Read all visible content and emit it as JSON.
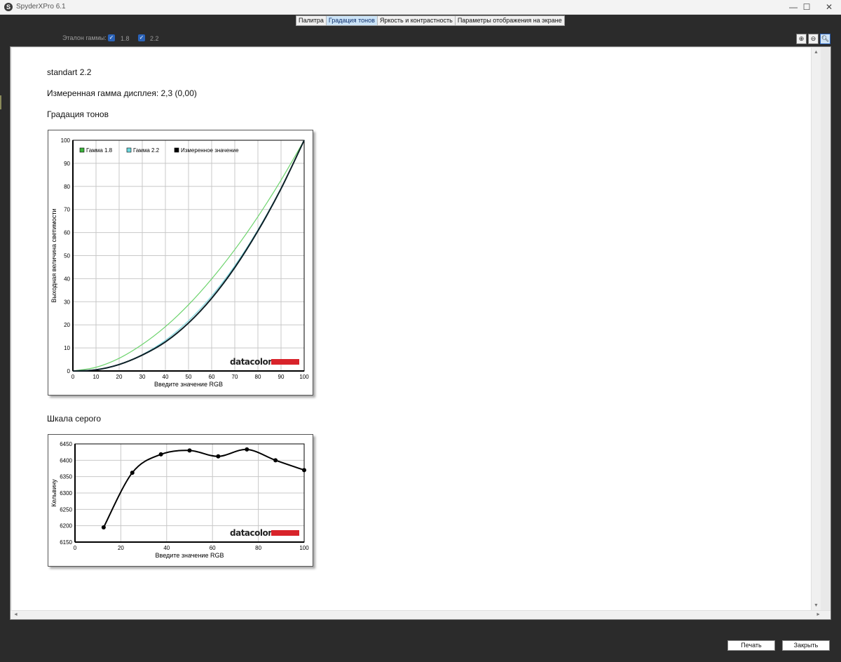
{
  "window": {
    "title": "SpyderXPro 6.1",
    "icon_text": "S",
    "controls": {
      "minimize": "—",
      "maximize": "☐",
      "close": "✕"
    }
  },
  "tabs": [
    {
      "label": "Палитра",
      "active": false
    },
    {
      "label": "Градация тонов",
      "active": true
    },
    {
      "label": "Яркость и контрастность",
      "active": false
    },
    {
      "label": "Параметры отображения на экране",
      "active": false
    }
  ],
  "gamma_reference": {
    "label": "Эталон гаммы:",
    "options": [
      {
        "label": "1.8",
        "checked": true
      },
      {
        "label": "2.2",
        "checked": true
      }
    ],
    "check_glyph": "✓"
  },
  "zoom_buttons": [
    {
      "icon": "zoom-in-icon",
      "glyph": "⊕"
    },
    {
      "icon": "zoom-out-icon",
      "glyph": "⊖"
    },
    {
      "icon": "zoom-fit-icon",
      "glyph": "🔍︎"
    }
  ],
  "report": {
    "profile_name": "standart 2.2",
    "measured_gamma": "Измеренная гамма дисплея: 2,3 (0,00)",
    "tone_section_title": "Градация тонов",
    "gray_section_title": "Шкала серого"
  },
  "chart_data": [
    {
      "type": "line",
      "title": "",
      "xlabel": "Введите значение RGB",
      "ylabel": "Выходная величина светимости",
      "xlim": [
        0,
        100
      ],
      "ylim": [
        0,
        100
      ],
      "x_ticks": [
        0,
        10,
        20,
        30,
        40,
        50,
        60,
        70,
        80,
        90,
        100
      ],
      "y_ticks": [
        0,
        10,
        20,
        30,
        40,
        50,
        60,
        70,
        80,
        90,
        100
      ],
      "grid": true,
      "legend_position": "top-left",
      "watermark": "datacolor",
      "series": [
        {
          "name": "Гамма 1.8",
          "color": "#6cd36c",
          "legend_color": "#3cb43c",
          "x": [
            0,
            10,
            20,
            30,
            40,
            50,
            60,
            70,
            80,
            90,
            100
          ],
          "y": [
            0,
            1.6,
            5.5,
            11.5,
            19.2,
            28.7,
            39.9,
            52.6,
            66.9,
            82.7,
            100
          ]
        },
        {
          "name": "Гамма 2.2",
          "color": "#7fd8e0",
          "legend_color": "#6cd8de",
          "x": [
            0,
            10,
            20,
            30,
            40,
            50,
            60,
            70,
            80,
            90,
            100
          ],
          "y": [
            0,
            0.6,
            2.9,
            7.1,
            13.3,
            21.8,
            32.5,
            45.6,
            61.2,
            79.3,
            100
          ]
        },
        {
          "name": "Измеренное значение",
          "color": "#0d1f26",
          "legend_color": "#000000",
          "x": [
            0,
            10,
            20,
            30,
            40,
            50,
            60,
            70,
            80,
            90,
            100
          ],
          "y": [
            0,
            0.5,
            2.8,
            6.9,
            12.6,
            20.8,
            31.5,
            44.8,
            60.7,
            79.0,
            100
          ]
        }
      ]
    },
    {
      "type": "line",
      "title": "",
      "xlabel": "Введите значение RGB",
      "ylabel": "Кельвину",
      "xlim": [
        0,
        100
      ],
      "ylim": [
        6150,
        6450
      ],
      "x_ticks": [
        0,
        20,
        40,
        60,
        80,
        100
      ],
      "y_ticks": [
        6150,
        6200,
        6250,
        6300,
        6350,
        6400,
        6450
      ],
      "grid": true,
      "watermark": "datacolor",
      "series": [
        {
          "color": "#000000",
          "x": [
            12.5,
            25,
            37.5,
            50,
            62.5,
            75,
            87.5,
            100
          ],
          "y": [
            6195,
            6362,
            6418,
            6430,
            6412,
            6433,
            6400,
            6370
          ]
        }
      ]
    }
  ],
  "buttons": {
    "print": "Печать",
    "close": "Закрыть"
  },
  "scroll_arrows": {
    "up": "▲",
    "down": "▼",
    "left": "◄",
    "right": "►"
  }
}
